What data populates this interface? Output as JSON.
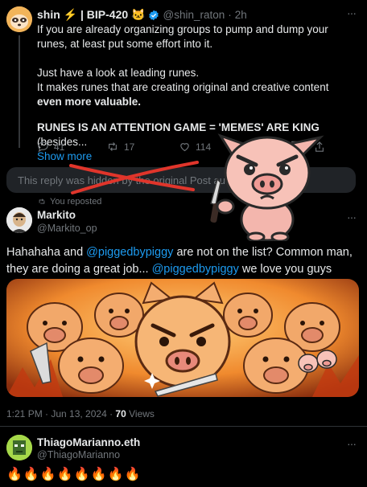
{
  "tweet1": {
    "display_name": "shin ⚡ | BIP-420 🐱",
    "handle": "@shin_raton",
    "separator": "·",
    "age": "2h",
    "more_label": "···",
    "line1": "If you are already organizing groups to pump and dump your runes, at least put some effort into it.",
    "line2": "Just have a look at leading runes.",
    "line3_prefix": "It makes runes that are creating original and creative content ",
    "line3_bold": "even more valuable.",
    "line4_bold": "RUNES IS AN ATTENTION GAME = 'MEMES' ARE KING",
    "line4_suffix": " (besides...",
    "show_more": "Show more",
    "replies": "41",
    "reposts": "17",
    "likes": "114"
  },
  "hidden_notice": {
    "text": "This reply was hidden by the original Post author."
  },
  "tweet2": {
    "reposted_label": "You reposted",
    "display_name": "Markito",
    "handle": "@Markito_op",
    "more_label": "···",
    "text_a": "Hahahaha and ",
    "mention1": "@piggedbypiggy",
    "text_b": " are not on the list? Common man, they are doing a great job... ",
    "mention2": "@piggedbypiggy",
    "text_c": " we love you guys",
    "timestamp": "1:21 PM · Jun 13, 2024 · ",
    "views_count": "70",
    "views_label": " Views"
  },
  "tweet3": {
    "display_name": "ThiagoMarianno.eth",
    "handle": "@ThiagoMarianno",
    "more_label": "···",
    "text": "🔥🔥🔥🔥🔥🔥🔥🔥"
  },
  "colors": {
    "background": "#000000",
    "text": "#e7e9ea",
    "muted": "#71767b",
    "link": "#1d9bf0",
    "verified": "#1d9bf0",
    "cross_out": "#e0352b"
  }
}
